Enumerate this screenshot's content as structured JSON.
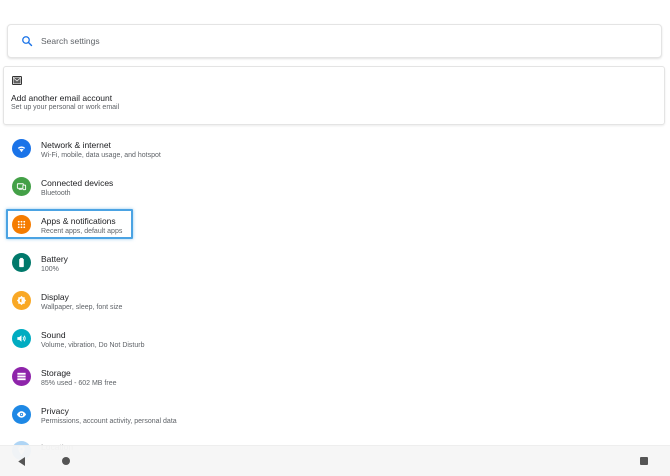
{
  "search": {
    "placeholder": "Search settings"
  },
  "email_suggestion": {
    "title": "Add another email account",
    "subtitle": "Set up your personal or work email"
  },
  "items": [
    {
      "label": "Network & internet",
      "summary": "Wi-Fi, mobile, data usage, and hotspot",
      "icon": "wifi-icon",
      "color": "#1a73e8"
    },
    {
      "label": "Connected devices",
      "summary": "Bluetooth",
      "icon": "devices-icon",
      "color": "#43a047"
    },
    {
      "label": "Apps & notifications",
      "summary": "Recent apps, default apps",
      "icon": "apps-grid-icon",
      "color": "#f57c00"
    },
    {
      "label": "Battery",
      "summary": "100%",
      "icon": "battery-icon",
      "color": "#00796b"
    },
    {
      "label": "Display",
      "summary": "Wallpaper, sleep, font size",
      "icon": "brightness-icon",
      "color": "#f9a825"
    },
    {
      "label": "Sound",
      "summary": "Volume, vibration, Do Not Disturb",
      "icon": "volume-icon",
      "color": "#00acc1"
    },
    {
      "label": "Storage",
      "summary": "85% used - 602 MB free",
      "icon": "storage-icon",
      "color": "#8e24aa"
    },
    {
      "label": "Privacy",
      "summary": "Permissions, account activity, personal data",
      "icon": "eye-icon",
      "color": "#1e88e5"
    },
    {
      "label": "Location",
      "summary": "",
      "icon": "location-icon",
      "color": "#1e88e5"
    }
  ],
  "highlight_color": "#4ba3e3"
}
